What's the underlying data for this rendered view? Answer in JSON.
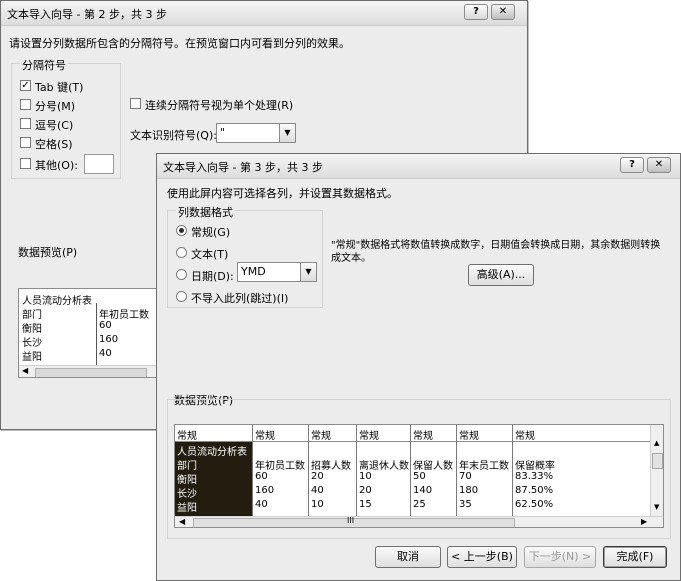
{
  "step2": {
    "title": "文本导入向导 - 第 2 步，共 3 步",
    "help_btn": "?",
    "close_btn": "✕",
    "instruction": "请设置分列数据所包含的分隔符号。在预览窗口内可看到分列的效果。",
    "delim_group": "分隔符号",
    "tab": "Tab 键(T)",
    "semicolon": "分号(M)",
    "comma": "逗号(C)",
    "space": "空格(S)",
    "other": "其他(O):",
    "consecutive": "连续分隔符号视为单个处理(R)",
    "qualifier_label": "文本识别符号(Q):",
    "qualifier_value": "\"",
    "preview_label": "数据预览(P)",
    "preview_rows": [
      [
        "人员流动分析表",
        ""
      ],
      [
        "部门",
        "年初员工数"
      ],
      [
        "衡阳",
        "60"
      ],
      [
        "长沙",
        "160"
      ],
      [
        "益阳",
        "40"
      ]
    ]
  },
  "step3": {
    "title": "文本导入向导 - 第 3 步，共 3 步",
    "help_btn": "?",
    "close_btn": "✕",
    "instruction": "使用此屏内容可选择各列，并设置其数据格式。",
    "format_group": "列数据格式",
    "general": "常规(G)",
    "text": "文本(T)",
    "date": "日期(D):",
    "date_value": "YMD",
    "skip": "不导入此列(跳过)(I)",
    "desc_line1": "\"常规\"数据格式将数值转换成数字，日期值会转换成日期，其余数据则转换",
    "desc_line2": "成文本。",
    "advanced": "高级(A)...",
    "preview_label": "数据预览(P)",
    "col_headers": [
      "常规",
      "常规",
      "常规",
      "常规",
      "常规",
      "常规",
      "常规"
    ],
    "preview_rows": [
      [
        "人员流动分析表",
        "",
        "",
        "",
        "",
        "",
        ""
      ],
      [
        "部门",
        "年初员工数",
        "招募人数",
        "离退休人数",
        "保留人数",
        "年末员工数",
        "保留概率"
      ],
      [
        "衡阳",
        "60",
        "20",
        "10",
        "50",
        "70",
        "83.33%"
      ],
      [
        "长沙",
        "160",
        "40",
        "20",
        "140",
        "180",
        "87.50%"
      ],
      [
        "益阳",
        "40",
        "10",
        "15",
        "25",
        "35",
        "62.50%"
      ]
    ],
    "scroll_mark": "III",
    "cancel": "取消",
    "back": "< 上一步(B)",
    "next": "下一步(N) >",
    "finish": "完成(F)"
  }
}
